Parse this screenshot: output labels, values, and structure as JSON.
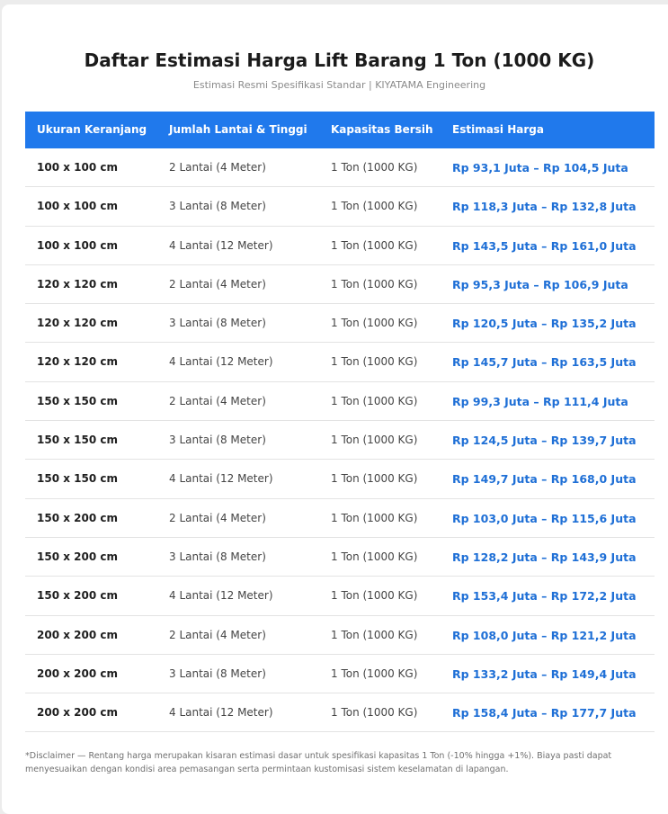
{
  "header": {
    "title": "Daftar Estimasi Harga Lift Barang 1 Ton (1000 KG)",
    "subtitle": "Estimasi Resmi Spesifikasi Standar | KIYATAMA Engineering"
  },
  "table": {
    "columns": [
      "Ukuran Keranjang",
      "Jumlah Lantai & Tinggi",
      "Kapasitas Bersih",
      "Estimasi Harga"
    ],
    "rows": [
      {
        "size": "100 x 100 cm",
        "floors": "2 Lantai (4 Meter)",
        "capacity": "1 Ton (1000 KG)",
        "price": "Rp 93,1 Juta – Rp 104,5 Juta"
      },
      {
        "size": "100 x 100 cm",
        "floors": "3 Lantai (8 Meter)",
        "capacity": "1 Ton (1000 KG)",
        "price": "Rp 118,3 Juta – Rp 132,8 Juta"
      },
      {
        "size": "100 x 100 cm",
        "floors": "4 Lantai (12 Meter)",
        "capacity": "1 Ton (1000 KG)",
        "price": "Rp 143,5 Juta – Rp 161,0 Juta"
      },
      {
        "size": "120 x 120 cm",
        "floors": "2 Lantai (4 Meter)",
        "capacity": "1 Ton (1000 KG)",
        "price": "Rp 95,3 Juta – Rp 106,9 Juta"
      },
      {
        "size": "120 x 120 cm",
        "floors": "3 Lantai (8 Meter)",
        "capacity": "1 Ton (1000 KG)",
        "price": "Rp 120,5 Juta – Rp 135,2 Juta"
      },
      {
        "size": "120 x 120 cm",
        "floors": "4 Lantai (12 Meter)",
        "capacity": "1 Ton (1000 KG)",
        "price": "Rp 145,7 Juta – Rp 163,5 Juta"
      },
      {
        "size": "150 x 150 cm",
        "floors": "2 Lantai (4 Meter)",
        "capacity": "1 Ton (1000 KG)",
        "price": "Rp 99,3 Juta – Rp 111,4 Juta"
      },
      {
        "size": "150 x 150 cm",
        "floors": "3 Lantai (8 Meter)",
        "capacity": "1 Ton (1000 KG)",
        "price": "Rp 124,5 Juta – Rp 139,7 Juta"
      },
      {
        "size": "150 x 150 cm",
        "floors": "4 Lantai (12 Meter)",
        "capacity": "1 Ton (1000 KG)",
        "price": "Rp 149,7 Juta – Rp 168,0 Juta"
      },
      {
        "size": "150 x 200 cm",
        "floors": "2 Lantai (4 Meter)",
        "capacity": "1 Ton (1000 KG)",
        "price": "Rp 103,0 Juta – Rp 115,6 Juta"
      },
      {
        "size": "150 x 200 cm",
        "floors": "3 Lantai (8 Meter)",
        "capacity": "1 Ton (1000 KG)",
        "price": "Rp 128,2 Juta – Rp 143,9 Juta"
      },
      {
        "size": "150 x 200 cm",
        "floors": "4 Lantai (12 Meter)",
        "capacity": "1 Ton (1000 KG)",
        "price": "Rp 153,4 Juta – Rp 172,2 Juta"
      },
      {
        "size": "200 x 200 cm",
        "floors": "2 Lantai (4 Meter)",
        "capacity": "1 Ton (1000 KG)",
        "price": "Rp 108,0 Juta – Rp 121,2 Juta"
      },
      {
        "size": "200 x 200 cm",
        "floors": "3 Lantai (8 Meter)",
        "capacity": "1 Ton (1000 KG)",
        "price": "Rp 133,2 Juta – Rp 149,4 Juta"
      },
      {
        "size": "200 x 200 cm",
        "floors": "4 Lantai (12 Meter)",
        "capacity": "1 Ton (1000 KG)",
        "price": "Rp 158,4 Juta – Rp 177,7 Juta"
      }
    ]
  },
  "disclaimer": "*Disclaimer — Rentang harga merupakan kisaran estimasi dasar untuk spesifikasi kapasitas 1 Ton (-10% hingga +1%). Biaya pasti dapat menyesuaikan dengan kondisi area pemasangan serta permintaan kustomisasi sistem keselamatan di lapangan.",
  "colors": {
    "header_bg": "#2079ec",
    "price_text": "#1e6fd6"
  }
}
